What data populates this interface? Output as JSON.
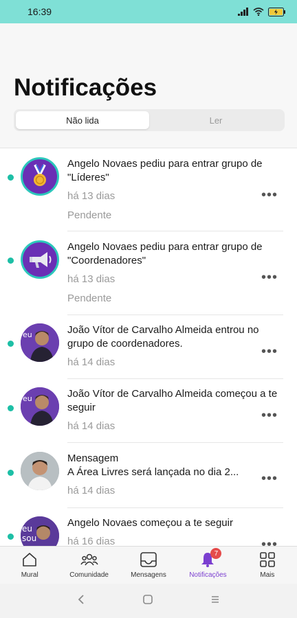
{
  "status_bar": {
    "time": "16:39",
    "battery_level": "charging"
  },
  "header": {
    "title": "Notificações",
    "tabs": [
      {
        "label": "Não lida",
        "active": true
      },
      {
        "label": "Ler",
        "active": false
      }
    ]
  },
  "notifications": [
    {
      "title": "Angelo Novaes pediu para entrar grupo de \"Líderes\"",
      "time": "há 13 dias",
      "status": "Pendente",
      "avatar": "medal-icon",
      "unread": true
    },
    {
      "title": "Angelo Novaes pediu para entrar grupo de \"Coordenadores\"",
      "time": "há 13 dias",
      "status": "Pendente",
      "avatar": "megaphone-icon",
      "unread": true
    },
    {
      "title": "João Vítor de Carvalho Almeida entrou no grupo de coordenadores.",
      "time": "há 14 dias",
      "avatar": "user-photo",
      "unread": true
    },
    {
      "title": "João Vítor de Carvalho Almeida começou a te seguir",
      "time": "há 14 dias",
      "avatar": "user-photo",
      "unread": true
    },
    {
      "title_line1": "Mensagem",
      "title_line2": "A Área Livres será lançada no dia 2...",
      "time": "há 14 dias",
      "avatar": "user-photo",
      "unread": true
    },
    {
      "title": "Angelo Novaes começou a te seguir",
      "time": "há 16 dias",
      "avatar": "user-photo",
      "unread": true
    }
  ],
  "bottom_nav": [
    {
      "label": "Mural",
      "icon": "home-icon"
    },
    {
      "label": "Comunidade",
      "icon": "community-icon"
    },
    {
      "label": "Mensagens",
      "icon": "inbox-icon"
    },
    {
      "label": "Notificações",
      "icon": "bell-icon",
      "badge": "7",
      "active": true
    },
    {
      "label": "Mais",
      "icon": "grid-icon"
    }
  ],
  "colors": {
    "accent": "#7b3fd0",
    "teal": "#2cc7bb",
    "unread_dot": "#1dbfa6",
    "status_bar": "#7fe0d6"
  }
}
